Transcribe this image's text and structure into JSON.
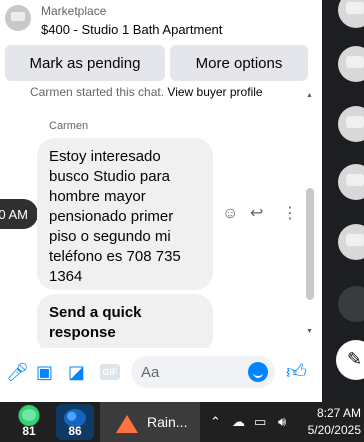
{
  "listing": {
    "category": "Marketplace",
    "title": "$400 - Studio 1 Bath Apartment"
  },
  "actions": {
    "mark_pending": "Mark as pending",
    "more_options": "More options"
  },
  "chat": {
    "started_prefix": "Carmen started this chat.",
    "view_profile": "View buyer profile",
    "sender": "Carmen",
    "time": "0 AM",
    "message": "Estoy interesado busco Studio para hombre mayor pensionado primer piso o segundo mi teléfono es 708 735 1364",
    "quick_response": "Send a quick response"
  },
  "composer": {
    "placeholder": "Aa",
    "icons": [
      "microphone-icon",
      "image-icon",
      "sticker-icon",
      "gif-icon",
      "emoji-icon",
      "thumbs-up-icon"
    ],
    "gif_label": "GIF"
  },
  "taskbar": {
    "apps": [
      {
        "name": "app-green",
        "badge": "81"
      },
      {
        "name": "app-blue",
        "badge": "86"
      }
    ],
    "weather": "Rain...",
    "time": "8:27 AM",
    "date": "5/20/2025"
  },
  "colors": {
    "accent": "#0084ff",
    "taskbar": "#202020",
    "sidebar": "#1c1e21"
  }
}
